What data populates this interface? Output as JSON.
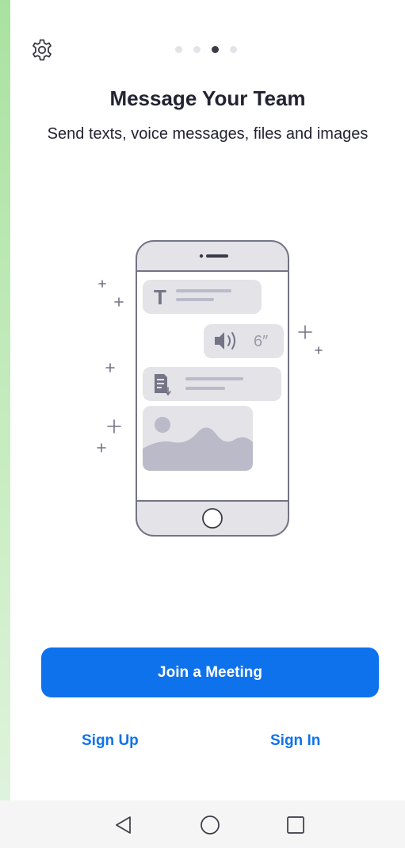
{
  "onboarding": {
    "title": "Message Your Team",
    "subtitle": "Send texts, voice messages, files and images",
    "pager": {
      "total": 4,
      "active_index": 2
    },
    "voice_message_duration": "6″",
    "text_bubble_glyph": "T"
  },
  "actions": {
    "join_label": "Join a Meeting",
    "sign_up_label": "Sign Up",
    "sign_in_label": "Sign In"
  },
  "icons": {
    "settings": "gear-icon",
    "nav_back": "triangle-back-icon",
    "nav_home": "circle-home-icon",
    "nav_recents": "square-recents-icon"
  },
  "colors": {
    "accent": "#0e72ed",
    "title_text": "#232333",
    "illustration_fill": "#e3e3e8",
    "illustration_stroke": "#747487",
    "illustration_shade": "#babac9",
    "nav_bar_bg": "#f5f5f5"
  }
}
